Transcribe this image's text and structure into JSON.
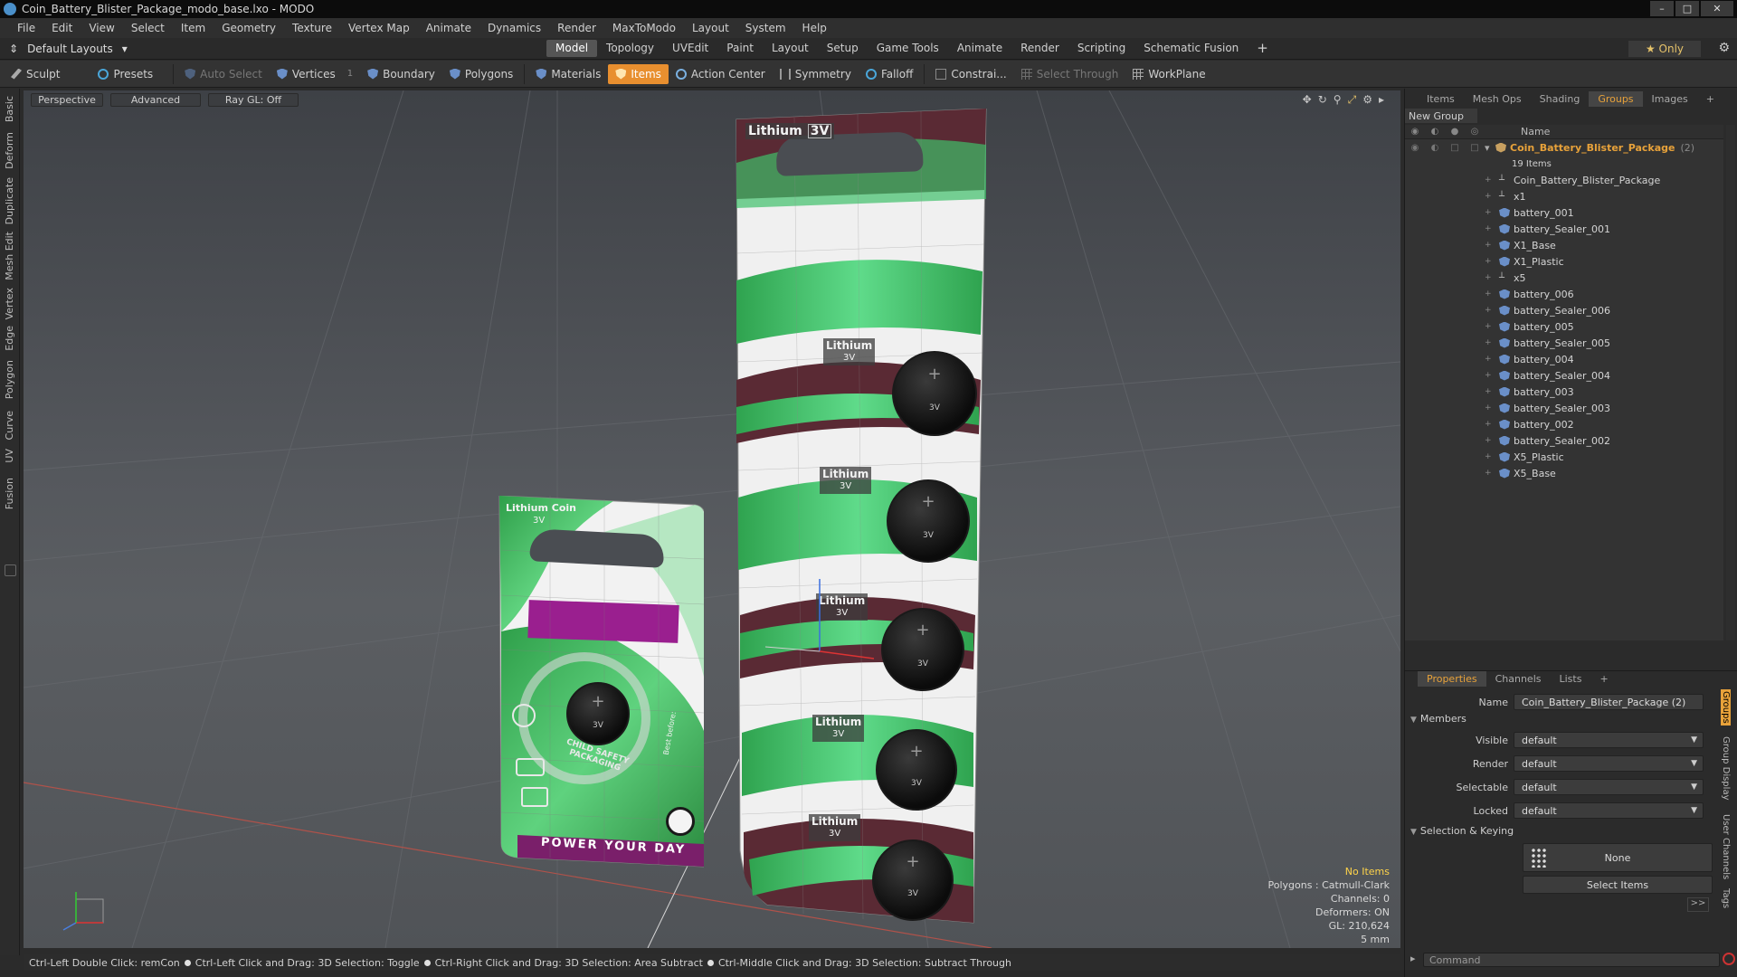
{
  "window": {
    "title": "Coin_Battery_Blister_Package_modo_base.lxo - MODO",
    "minimize": "–",
    "maximize": "□",
    "close": "✕"
  },
  "menu": [
    "File",
    "Edit",
    "View",
    "Select",
    "Item",
    "Geometry",
    "Texture",
    "Vertex Map",
    "Animate",
    "Dynamics",
    "Render",
    "MaxToModo",
    "Layout",
    "System",
    "Help"
  ],
  "layout": {
    "selector": "Default Layouts",
    "tabs": [
      "Model",
      "Topology",
      "UVEdit",
      "Paint",
      "Layout",
      "Setup",
      "Game Tools",
      "Animate",
      "Render",
      "Scripting",
      "Schematic Fusion"
    ],
    "active_tab": "Model",
    "add_tab": "+",
    "only_label": "★ Only"
  },
  "toolbar": {
    "sculpt": "Sculpt",
    "presets": "Presets",
    "auto_select": "Auto Select",
    "vertices": "Vertices",
    "vertices_count": "1",
    "boundary": "Boundary",
    "polygons": "Polygons",
    "materials": "Materials",
    "items": "Items",
    "action_center": "Action Center",
    "symmetry": "Symmetry",
    "falloff": "Falloff",
    "constraints": "Constrai...",
    "select_through": "Select Through",
    "workplane": "WorkPlane"
  },
  "left_tabs": [
    "Basic",
    "Deform",
    "Duplicate",
    "Mesh Edit",
    "Vertex",
    "Edge",
    "Polygon",
    "Curve",
    "UV",
    "Fusion"
  ],
  "viewport": {
    "view": "Perspective",
    "shading": "Advanced",
    "raygl": "Ray GL: Off",
    "info": {
      "selection": "No Items",
      "polygons": "Polygons : Catmull-Clark",
      "channels": "Channels: 0",
      "deformers": "Deformers: ON",
      "gl": "GL: 210,624",
      "scale": "5 mm"
    },
    "small_package": {
      "title": "Lithium Coin",
      "voltage": "3V",
      "slogan": "POWER YOUR DAY",
      "ring_text": "CHILD SAFETY PACKAGING",
      "best_before": "Best before:"
    },
    "big_package": {
      "title": "Lithium",
      "voltage": "3V",
      "labels": [
        {
          "title": "Lithium",
          "voltage": "3V"
        },
        {
          "title": "Lithium",
          "voltage": "3V"
        },
        {
          "title": "Lithium",
          "voltage": "3V"
        },
        {
          "title": "Lithium",
          "voltage": "3V"
        },
        {
          "title": "Lithium",
          "voltage": "3V"
        }
      ]
    },
    "coin": {
      "plus": "+",
      "voltage": "3V"
    }
  },
  "status_bar": [
    "Ctrl-Left Double Click: remCon",
    "Ctrl-Left Click and Drag: 3D Selection: Toggle",
    "Ctrl-Right Click and Drag: 3D Selection: Area Subtract",
    "Ctrl-Middle Click and Drag: 3D Selection: Subtract Through"
  ],
  "right_panel": {
    "tabs": [
      "Items",
      "Mesh Ops",
      "Shading",
      "Groups",
      "Images"
    ],
    "active_tab": "Groups",
    "add_tab": "+",
    "new_group": "New Group",
    "list_header": "Name",
    "group": {
      "name": "Coin_Battery_Blister_Package",
      "count": "(2)",
      "items_label": "19 Items"
    },
    "items": [
      {
        "name": "Coin_Battery_Blister_Package",
        "type": "locator"
      },
      {
        "name": "x1",
        "type": "locator"
      },
      {
        "name": "battery_001",
        "type": "mesh"
      },
      {
        "name": "battery_Sealer_001",
        "type": "mesh"
      },
      {
        "name": "X1_Base",
        "type": "mesh"
      },
      {
        "name": "X1_Plastic",
        "type": "mesh"
      },
      {
        "name": "x5",
        "type": "locator"
      },
      {
        "name": "battery_006",
        "type": "mesh"
      },
      {
        "name": "battery_Sealer_006",
        "type": "mesh"
      },
      {
        "name": "battery_005",
        "type": "mesh"
      },
      {
        "name": "battery_Sealer_005",
        "type": "mesh"
      },
      {
        "name": "battery_004",
        "type": "mesh"
      },
      {
        "name": "battery_Sealer_004",
        "type": "mesh"
      },
      {
        "name": "battery_003",
        "type": "mesh"
      },
      {
        "name": "battery_Sealer_003",
        "type": "mesh"
      },
      {
        "name": "battery_002",
        "type": "mesh"
      },
      {
        "name": "battery_Sealer_002",
        "type": "mesh"
      },
      {
        "name": "X5_Plastic",
        "type": "mesh"
      },
      {
        "name": "X5_Base",
        "type": "mesh"
      }
    ]
  },
  "properties": {
    "tabs": [
      "Properties",
      "Channels",
      "Lists"
    ],
    "active_tab": "Properties",
    "add_tab": "+",
    "name_label": "Name",
    "name_value": "Coin_Battery_Blister_Package (2)",
    "members_section": "Members",
    "visible_label": "Visible",
    "visible_value": "default",
    "render_label": "Render",
    "render_value": "default",
    "selectable_label": "Selectable",
    "selectable_value": "default",
    "locked_label": "Locked",
    "locked_value": "default",
    "keying_section": "Selection & Keying",
    "none_button": "None",
    "select_items_button": "Select Items",
    "more": ">>",
    "side_tabs": [
      "Groups",
      "Group Display",
      "User Channels",
      "Tags"
    ],
    "command_placeholder": "Command"
  },
  "colors": {
    "accent": "#e8a23a",
    "active_tool": "#e88f2f",
    "package_green": "#3fbf6a",
    "package_maroon": "#5a2a34",
    "label_purple": "#9a1f8f",
    "info_yellow": "#ffd44a"
  }
}
